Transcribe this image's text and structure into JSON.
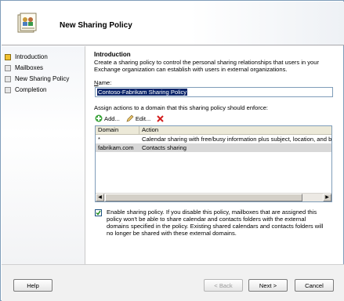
{
  "banner": {
    "title": "New Sharing Policy"
  },
  "nav": {
    "items": [
      {
        "label": "Introduction",
        "active": true
      },
      {
        "label": "Mailboxes",
        "active": false
      },
      {
        "label": "New Sharing Policy",
        "active": false
      },
      {
        "label": "Completion",
        "active": false
      }
    ]
  },
  "main": {
    "heading": "Introduction",
    "description": "Create a sharing policy to control the personal sharing relationships that users in your Exchange organization can establish with users in external organizations.",
    "name_label_prefix": "N",
    "name_label_rest": "ame:",
    "name_value": "Contoso-Fabrikam Sharing Policy",
    "assign_label": "Assign actions to a domain that this sharing policy should enforce:",
    "toolbar": {
      "add": "Add...",
      "edit": "Edit..."
    },
    "list": {
      "columns": [
        "Domain",
        "Action"
      ],
      "rows": [
        {
          "domain": "*",
          "action": "Calendar sharing with free/busy information plus subject, location, and bo"
        },
        {
          "domain": "fabrikam.com",
          "action": "Contacts sharing"
        }
      ]
    },
    "enable_text": "Enable sharing policy. If you disable this policy, mailboxes that are assigned this policy won't be able to share calendar and contacts folders with the external domains specified in the policy. Existing shared calendars and contacts folders will no longer be shared with these external domains.",
    "enable_checked": true
  },
  "footer": {
    "help": "Help",
    "back": "< Back",
    "next": "Next >",
    "cancel": "Cancel"
  }
}
